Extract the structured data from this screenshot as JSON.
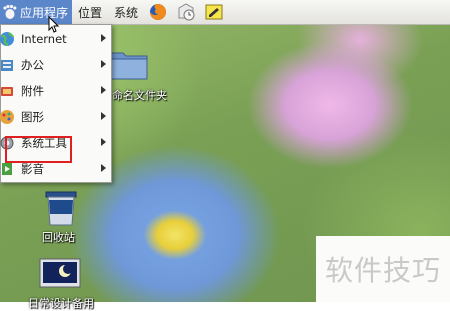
{
  "panel": {
    "menus": [
      {
        "label": "应用程序",
        "active": true
      },
      {
        "label": "位置"
      },
      {
        "label": "系统"
      }
    ],
    "launchers": [
      "firefox-icon",
      "mail-clock-icon",
      "notes-icon"
    ]
  },
  "menu": {
    "items": [
      {
        "label": "Internet",
        "icon": "globe-icon"
      },
      {
        "label": "办公",
        "icon": "office-icon"
      },
      {
        "label": "附件",
        "icon": "accessories-icon"
      },
      {
        "label": "图形",
        "icon": "graphics-icon"
      },
      {
        "label": "系统工具",
        "icon": "system-tools-icon",
        "highlighted": true
      },
      {
        "label": "影音",
        "icon": "media-icon"
      }
    ]
  },
  "desktop": {
    "folder_label": "命名文件夹",
    "trash_label": "回收站",
    "computer_label": "日常设计备用"
  },
  "watermark": {
    "text": "软件技巧"
  },
  "colors": {
    "panel_active": "#5b86c9",
    "highlight_box": "#e02020"
  }
}
